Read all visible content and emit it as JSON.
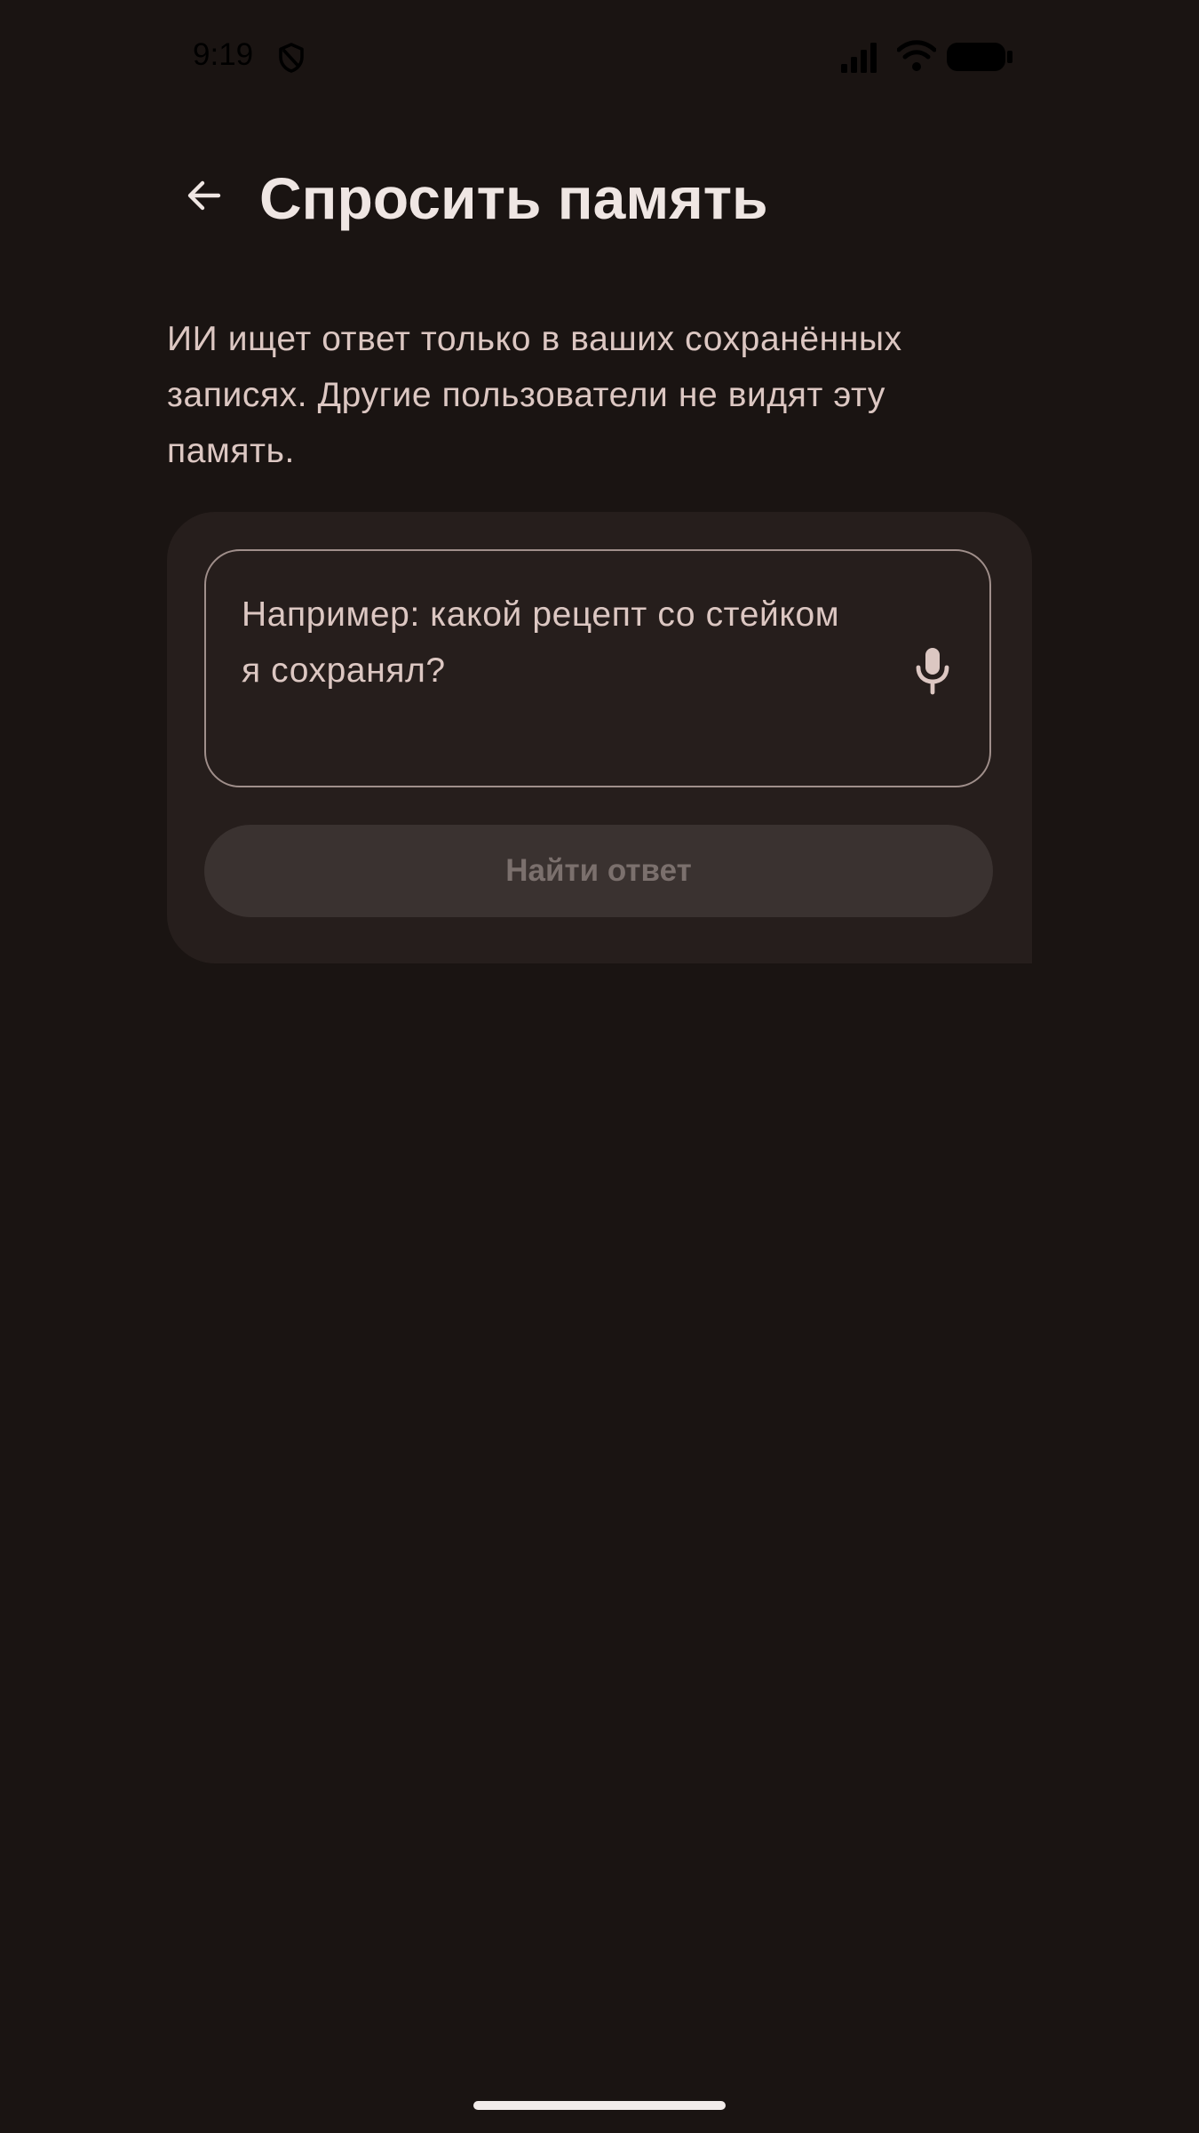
{
  "status_bar": {
    "time": "9:19"
  },
  "header": {
    "title": "Спросить память",
    "back_icon": "arrow-left-icon"
  },
  "description": "ИИ ищет ответ только в ваших сохранённых записях. Другие пользователи не видят эту память.",
  "query": {
    "value": "",
    "placeholder": "Например: какой рецепт со стейком я сохранял?",
    "mic_icon": "microphone-icon"
  },
  "submit": {
    "label": "Найти ответ",
    "enabled": false
  },
  "colors": {
    "background": "#1a1412",
    "card": "#261e1c",
    "text_primary": "#efe6e3",
    "text_secondary": "#dcc7c2",
    "outline": "#a08f8b",
    "button_disabled_bg": "#3a3230",
    "button_disabled_text": "#7b706d"
  }
}
